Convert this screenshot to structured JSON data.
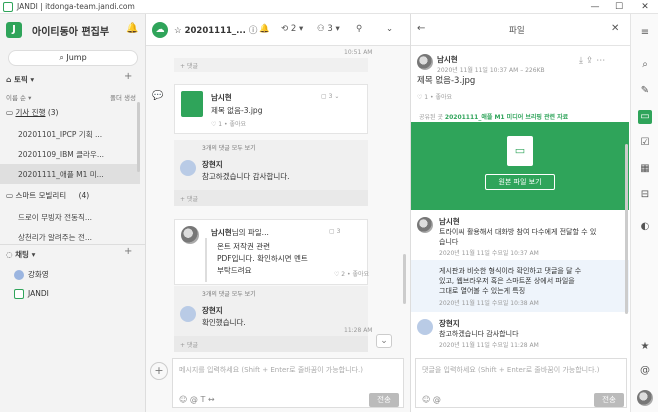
{
  "window": {
    "title": "JANDI | itdonga-team.jandi.com",
    "buttons": [
      "—",
      "☐",
      "✕"
    ]
  },
  "sidebar": {
    "workspace_name": "아이티동아 편집부",
    "jump_label": "Jump",
    "topics_header": "토픽",
    "sort_label": "이름 순",
    "create_folder_label": "폴더 생성",
    "folders": [
      {
        "label": "기사 진행",
        "count": "(3)"
      },
      {
        "label": "스마트 모빌리티",
        "count": "(4)"
      }
    ],
    "rooms_a": [
      "20201101_IPCP 기획 ...",
      "20201109_IBM 클라우...",
      "20201111_애플 M1 미..."
    ],
    "rooms_b": [
      "드로이 무빙자 전동직...",
      "상천리가 알려주는 전..."
    ],
    "chat_header": "채팅",
    "dms": [
      {
        "name": "강화영"
      },
      {
        "name": "JANDI"
      }
    ]
  },
  "chat": {
    "channel_title": "20201111_...",
    "member_count": "2",
    "people_count": "3",
    "first_time": "10:51 AM",
    "comment_label": "댓글",
    "msg1": {
      "sender": "남시현",
      "file_name": "제목 없음-3.jpg",
      "comment_count": "3",
      "likes": "1 • 좋아요"
    },
    "msg1_comments_all": "3개의 댓글 모두 보기",
    "msg1_comment": {
      "sender": "장현지",
      "text": "참고하겠습니다 감사합니다."
    },
    "msg2": {
      "sender": "남시현",
      "title": "님의 파일...",
      "count": "3",
      "lines": [
        "온트 저작권 관련",
        "PDF입니다. 확인하시면 멘트",
        "부탁드려요"
      ],
      "likes": "2 • 좋아요"
    },
    "msg2_comments_all": "3개의 댓글 모두 보기",
    "msg2_comment": {
      "sender": "장현지",
      "text": "확인했습니다."
    },
    "msg2_time": "11:28 AM",
    "input_placeholder": "메시지를 입력하세요 (Shift + Enter로 줄바꿈이 가능합니다.)",
    "send_label": "전송"
  },
  "panel": {
    "title": "파일",
    "uploader": "남시현",
    "upload_meta": "2020년 11월 11일 10:37 AM – 226KB",
    "file_name": "제목 없음-3.jpg",
    "comment_stat": "1 • 좋아요",
    "shared_prefix": "공유된 곳",
    "shared_channel": "20201111_애플 M1 미디어 브리핑 관련 자료",
    "view_original": "원본 파일 보기",
    "comments": [
      {
        "sender": "남시현",
        "text": [
          "트라이씨 활용해서 대화방 참여 다수에게 전달할 수 있",
          "습니다"
        ],
        "time": "2020년 11월 11일 수요일 10:37 AM"
      },
      {
        "sender": "",
        "text": [
          "게시판과 비슷한 형식이라 확인하고 댓글을 달 수",
          "있고, 웹브라우저 혹은 스마트폰 상에서 파일을",
          "그대로 열어볼 수 있는게 특징"
        ],
        "time": "2020년 11월 11일 수요일 10:38 AM"
      },
      {
        "sender": "장현지",
        "text": [
          "참고하겠습니다 감사합니다"
        ],
        "time": "2020년 11월 11일 수요일 11:28 AM"
      }
    ],
    "input_placeholder": "댓글을 입력하세요 (Shift + Enter로 줄바꿈이 가능합니다.)",
    "send_label": "전송"
  },
  "colors": {
    "brand": "#2fa45a",
    "accent_text": "#2fa45a"
  }
}
